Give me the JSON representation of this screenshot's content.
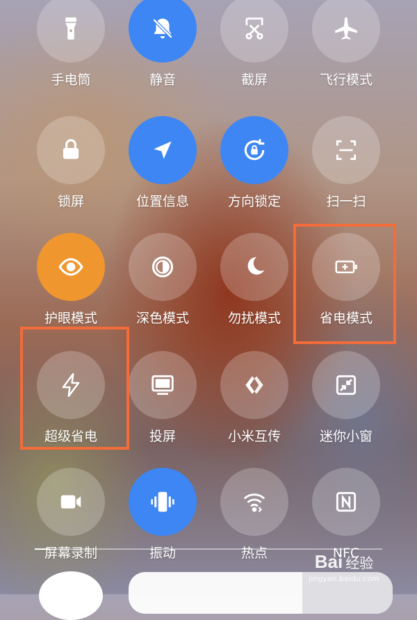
{
  "tiles": [
    {
      "label": "手电筒",
      "icon": "flashlight-icon",
      "active": false
    },
    {
      "label": "静音",
      "icon": "mute-icon",
      "active": true
    },
    {
      "label": "截屏",
      "icon": "screenshot-icon",
      "active": false
    },
    {
      "label": "飞行模式",
      "icon": "airplane-icon",
      "active": false
    },
    {
      "label": "锁屏",
      "icon": "lock-icon",
      "active": false
    },
    {
      "label": "位置信息",
      "icon": "location-icon",
      "active": true
    },
    {
      "label": "方向锁定",
      "icon": "rotation-lock-icon",
      "active": true
    },
    {
      "label": "扫一扫",
      "icon": "scan-icon",
      "active": false
    },
    {
      "label": "护眼模式",
      "icon": "eye-icon",
      "active": true
    },
    {
      "label": "深色模式",
      "icon": "dark-mode-icon",
      "active": false
    },
    {
      "label": "勿扰模式",
      "icon": "moon-icon",
      "active": false
    },
    {
      "label": "省电模式",
      "icon": "battery-saver-icon",
      "active": false
    },
    {
      "label": "超级省电",
      "icon": "lightning-icon",
      "active": false
    },
    {
      "label": "投屏",
      "icon": "cast-screen-icon",
      "active": false
    },
    {
      "label": "小米互传",
      "icon": "mi-share-icon",
      "active": false
    },
    {
      "label": "迷你小窗",
      "icon": "mini-window-icon",
      "active": false
    },
    {
      "label": "屏幕录制",
      "icon": "screen-record-icon",
      "active": false
    },
    {
      "label": "振动",
      "icon": "vibrate-icon",
      "active": true
    },
    {
      "label": "热点",
      "icon": "hotspot-icon",
      "active": false
    },
    {
      "label": "NFC",
      "icon": "nfc-icon",
      "active": false
    }
  ],
  "colors": {
    "active_blue": "#3d86f3",
    "eye_orange": "#f0962e",
    "highlight_orange": "#f36c3a"
  },
  "watermark": {
    "logo": "Bai",
    "logo_suffix": "经验",
    "url": "jingyan.baidu.com"
  }
}
